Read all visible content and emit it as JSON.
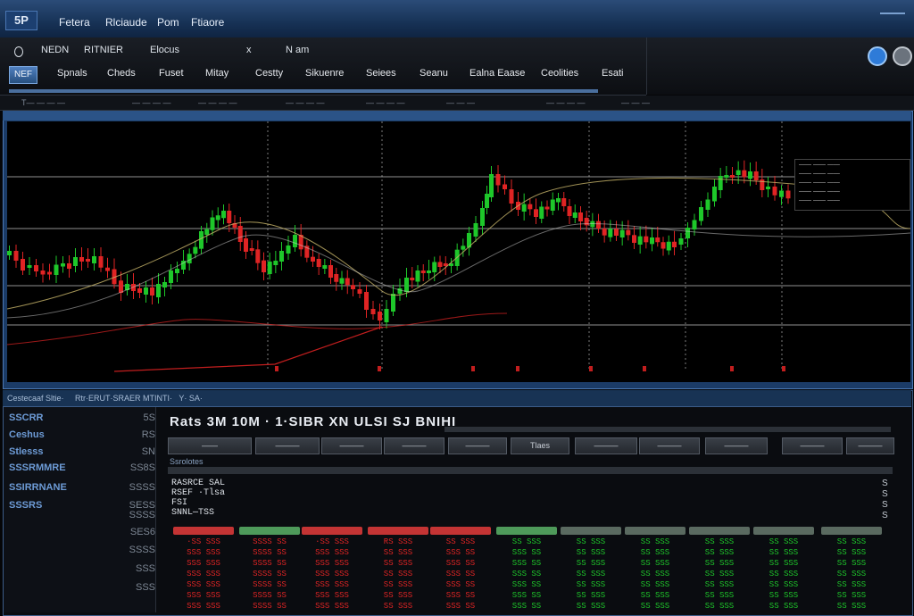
{
  "app": {
    "logo": "5P",
    "menu": [
      "Fetera",
      "Rlciaude",
      "Pom",
      "Ftiaore"
    ]
  },
  "toolbar": {
    "row1": [
      "NEDN",
      "RITNIER",
      "Elocus",
      "x",
      "N am"
    ],
    "home_tab": "NEF",
    "tabs": [
      "Spnals",
      "Cheds",
      "Fuset",
      "Mitay",
      "Cestty",
      "Sikuenre",
      "Seiees",
      "Seanu",
      "Ealna Eaase",
      "Ceolities",
      "Esati"
    ]
  },
  "status_strip": [
    "T— — — —",
    "— — — —",
    "— — — —",
    "— — — —",
    "— — — —",
    "— — —",
    "— — — —",
    "— — —"
  ],
  "chart": {
    "colors": {
      "up": "#1ec72a",
      "down": "#e02424",
      "ma1": "#c8b56a",
      "ma2": "#d4d4d4",
      "volume": "#c21e1e",
      "grid": "#cfcfcf"
    },
    "legend_lines": [
      "—— —— ——",
      "—— —— ——",
      "—— —— ——",
      "—— —— ——",
      "—— —— ——"
    ]
  },
  "bottom": {
    "title": "Cestecaaf Sltie·      Rtr·ERUT·SRAER MTINTI·   Y· SA·",
    "sidebar": [
      {
        "label": "SSCRR",
        "num": "5S"
      },
      {
        "label": "Ceshus",
        "num": "RS"
      },
      {
        "label": "Stlesss",
        "num": "SN"
      },
      {
        "label": "SSSRMMRE",
        "num": "SS8S"
      },
      {
        "label": "SSIRRNANE",
        "num": "SSSS"
      },
      {
        "label": "SSSRS",
        "num": "SESS"
      },
      {
        "label": "",
        "num": "SSSS"
      },
      {
        "label": "",
        "num": "SES6"
      },
      {
        "label": "",
        "num": "SSSS"
      },
      {
        "label": "",
        "num": "SSS"
      },
      {
        "label": "",
        "num": "SSS"
      }
    ],
    "rates_title": "Rats  3M   10M  · 1·SIBR XN ULSI SJ BNIHI",
    "sub_tabs": [
      "——",
      "———",
      "———",
      "———",
      "———",
      "Tlaes",
      "———",
      "———",
      "———",
      "———",
      "———"
    ],
    "info_label": "Ssrolotes",
    "info_lines": [
      "RASRCE SAL",
      "RSEF ·Tlsa",
      "FSI",
      "SNNL—TSS"
    ],
    "right_ticks": [
      "S",
      "S",
      "S",
      "S"
    ],
    "column_colors": [
      "#c43434",
      "#4e9a5a",
      "#c43434",
      "#c43434",
      "#c43434",
      "#4e9a5a",
      "#5a6a60",
      "#5a6a60",
      "#5a6a60",
      "#5a6a60",
      "#5a6a60"
    ],
    "cell_colors": [
      "#e02424",
      "#e02424",
      "#e02424",
      "#e02424",
      "#e02424",
      "#1ec72a",
      "#1ec72a",
      "#1ec72a",
      "#1ec72a",
      "#1ec72a",
      "#1ec72a"
    ],
    "cells": [
      [
        "·SS SSS",
        "SSSS SS",
        "·SS SSS",
        "RS SSS",
        "SS SSS",
        "SS SSS",
        "SS SSS",
        "SS SSS",
        "SS SSS",
        "SS SSS",
        "SS SSS"
      ],
      [
        "SSS SSS",
        "SSSS SS",
        "SSS SSS",
        "SS SSS",
        "SSS SS",
        "SSS SS",
        "SS SSS",
        "SS SSS",
        "SS SSS",
        "SS SSS",
        "SS SSS"
      ],
      [
        "SSS SSS",
        "SSSS SS",
        "SSS SSS",
        "SS SSS",
        "SSS SS",
        "SSS SS",
        "SS SSS",
        "SS SSS",
        "SS SSS",
        "SS SSS",
        "SS SSS"
      ],
      [
        "SSS SSS",
        "SSSS SS",
        "SSS SSS",
        "SS SSS",
        "SSS SS",
        "SSS SS",
        "SS SSS",
        "SS SSS",
        "SS SSS",
        "SS SSS",
        "SS SSS"
      ],
      [
        "SSS SSS",
        "SSSS SS",
        "SSS SSS",
        "SS SSS",
        "SSS SS",
        "SSS SS",
        "SS SSS",
        "SS SSS",
        "SS SSS",
        "SS SSS",
        "SS SSS"
      ],
      [
        "SSS SSS",
        "SSSS SS",
        "SSS SSS",
        "SS SSS",
        "SSS SS",
        "SSS SS",
        "SS SSS",
        "SS SSS",
        "SS SSS",
        "SS SSS",
        "SS SSS"
      ],
      [
        "SSS SSS",
        "SSSS SS",
        "SSS SSS",
        "SS SSS",
        "SSS SS",
        "SSS SS",
        "SS SSS",
        "SS SSS",
        "SS SSS",
        "SS SSS",
        "SS SSS"
      ]
    ]
  }
}
